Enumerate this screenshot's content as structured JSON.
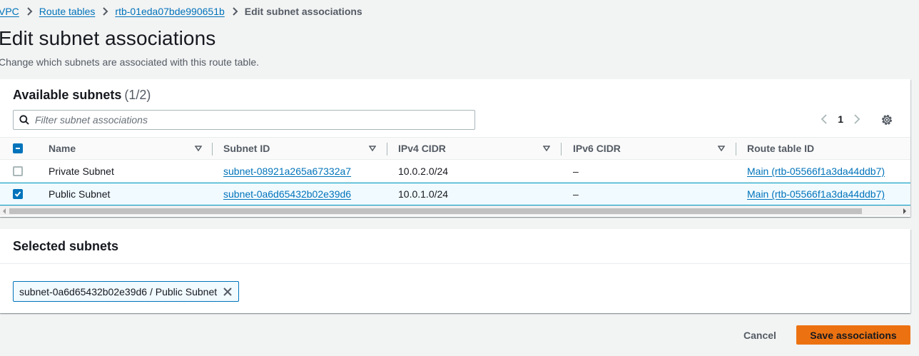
{
  "breadcrumb": {
    "items": [
      "VPC",
      "Route tables",
      "rtb-01eda07bde990651b"
    ],
    "current": "Edit subnet associations"
  },
  "page": {
    "title": "Edit subnet associations",
    "description": "Change which subnets are associated with this route table."
  },
  "available": {
    "title": "Available subnets",
    "count": "(1/2)",
    "filter_placeholder": "Filter subnet associations",
    "page_number": "1",
    "columns": [
      "Name",
      "Subnet ID",
      "IPv4 CIDR",
      "IPv6 CIDR",
      "Route table ID"
    ],
    "rows": [
      {
        "name": "Private Subnet",
        "subnet_id": "subnet-08921a265a67332a7",
        "ipv4": "10.0.2.0/24",
        "ipv6": "–",
        "route_table": "Main (rtb-05566f1a3da44ddb7)",
        "selected": false
      },
      {
        "name": "Public Subnet",
        "subnet_id": "subnet-0a6d65432b02e39d6",
        "ipv4": "10.0.1.0/24",
        "ipv6": "–",
        "route_table": "Main (rtb-05566f1a3da44ddb7)",
        "selected": true
      }
    ]
  },
  "selected": {
    "title": "Selected subnets",
    "tokens": [
      "subnet-0a6d65432b02e39d6 / Public Subnet"
    ]
  },
  "actions": {
    "cancel": "Cancel",
    "save": "Save associations"
  },
  "colors": {
    "link": "#0073bb",
    "primary": "#ec7211",
    "background": "#f2f3f3"
  }
}
